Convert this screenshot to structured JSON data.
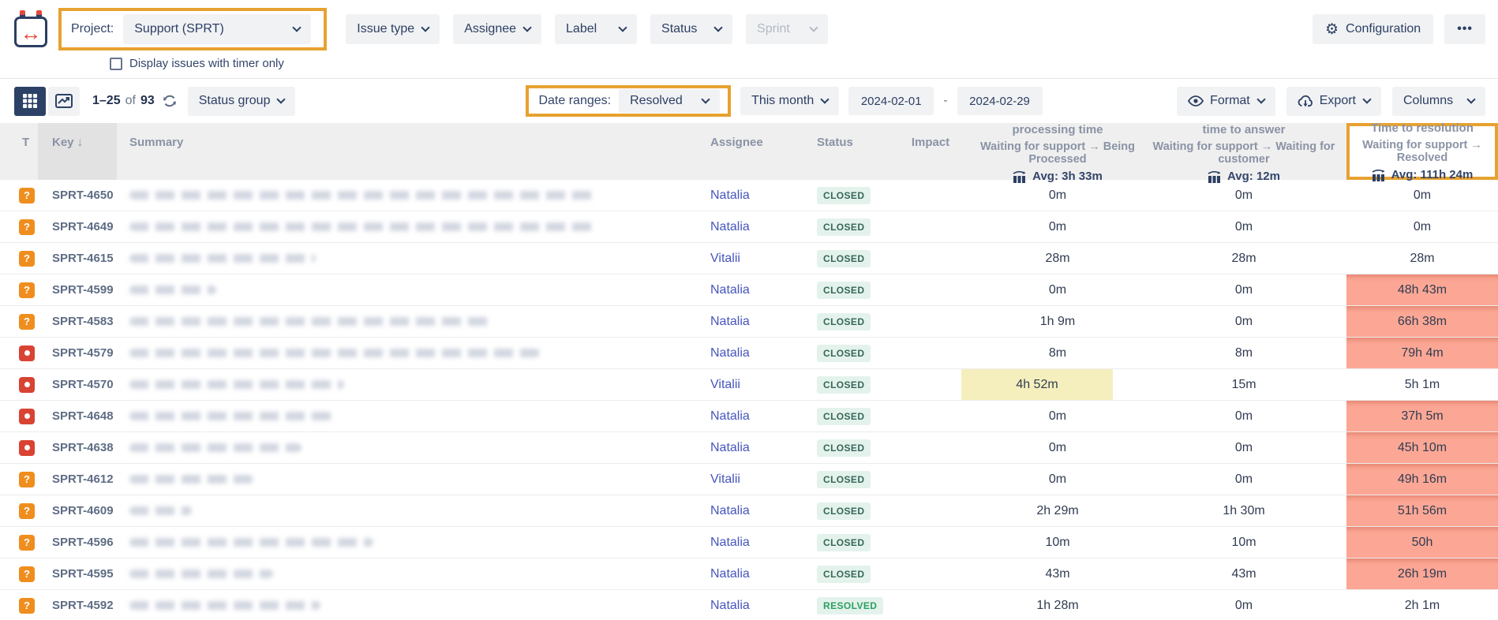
{
  "brand": {
    "logo": "calendar-sync-logo",
    "logo_arrow_glyph": "↔"
  },
  "filters": {
    "project_label": "Project:",
    "project_value": "Support (SPRT)",
    "issue_type": "Issue type",
    "assignee": "Assignee",
    "label": "Label",
    "status": "Status",
    "sprint": "Sprint"
  },
  "topbar_actions": {
    "configuration": "Configuration",
    "more": "•••"
  },
  "timer_checkbox_label": "Display issues with timer only",
  "toolbar": {
    "pagination_range": "1–25",
    "pagination_of": "of",
    "pagination_total": "93",
    "status_group": "Status group",
    "date_ranges_label": "Date ranges:",
    "date_ranges_value": "Resolved",
    "period": "This month",
    "date_from": "2024-02-01",
    "date_dash": "-",
    "date_to": "2024-02-29",
    "format": "Format",
    "export": "Export",
    "columns": "Columns"
  },
  "table": {
    "headers": {
      "type": "T",
      "key": "Key",
      "sort_desc_glyph": "↓",
      "summary": "Summary",
      "assignee": "Assignee",
      "status": "Status",
      "impact": "Impact",
      "processing": {
        "title": "processing time",
        "subtitle": "Waiting for support → Being Processed",
        "avg": "Avg: 3h 33m"
      },
      "answer": {
        "title": "time to answer",
        "subtitle": "Waiting for support → Waiting for customer",
        "avg": "Avg: 12m"
      },
      "resolution": {
        "title": "Time to resolution",
        "subtitle": "Waiting for support → Resolved",
        "avg": "Avg: 111h 24m"
      }
    },
    "rows": [
      {
        "key": "SPRT-4650",
        "type": "question",
        "assignee": "Natalia",
        "status": "CLOSED",
        "processing": "0m",
        "answer": "0m",
        "resolution": "0m",
        "resolution_alert": false,
        "processing_highlight": false,
        "summary_blur_width": 590
      },
      {
        "key": "SPRT-4649",
        "type": "question",
        "assignee": "Natalia",
        "status": "CLOSED",
        "processing": "0m",
        "answer": "0m",
        "resolution": "0m",
        "resolution_alert": false,
        "processing_highlight": false,
        "summary_blur_width": 590
      },
      {
        "key": "SPRT-4615",
        "type": "question",
        "assignee": "Vitalii",
        "status": "CLOSED",
        "processing": "28m",
        "answer": "28m",
        "resolution": "28m",
        "resolution_alert": false,
        "processing_highlight": false,
        "summary_blur_width": 236
      },
      {
        "key": "SPRT-4599",
        "type": "question",
        "assignee": "Natalia",
        "status": "CLOSED",
        "processing": "0m",
        "answer": "0m",
        "resolution": "48h 43m",
        "resolution_alert": true,
        "processing_highlight": false,
        "summary_blur_width": 110
      },
      {
        "key": "SPRT-4583",
        "type": "question",
        "assignee": "Natalia",
        "status": "CLOSED",
        "processing": "1h 9m",
        "answer": "0m",
        "resolution": "66h 38m",
        "resolution_alert": true,
        "processing_highlight": false,
        "summary_blur_width": 460
      },
      {
        "key": "SPRT-4579",
        "type": "bug",
        "assignee": "Natalia",
        "status": "CLOSED",
        "processing": "8m",
        "answer": "8m",
        "resolution": "79h 4m",
        "resolution_alert": true,
        "processing_highlight": false,
        "summary_blur_width": 520
      },
      {
        "key": "SPRT-4570",
        "type": "bug",
        "assignee": "Vitalii",
        "status": "CLOSED",
        "processing": "4h 52m",
        "answer": "15m",
        "resolution": "5h 1m",
        "resolution_alert": false,
        "processing_highlight": true,
        "summary_blur_width": 272
      },
      {
        "key": "SPRT-4648",
        "type": "bug",
        "assignee": "Natalia",
        "status": "CLOSED",
        "processing": "0m",
        "answer": "0m",
        "resolution": "37h 5m",
        "resolution_alert": true,
        "processing_highlight": false,
        "summary_blur_width": 260
      },
      {
        "key": "SPRT-4638",
        "type": "bug",
        "assignee": "Natalia",
        "status": "CLOSED",
        "processing": "0m",
        "answer": "0m",
        "resolution": "45h 10m",
        "resolution_alert": true,
        "processing_highlight": false,
        "summary_blur_width": 218
      },
      {
        "key": "SPRT-4612",
        "type": "question",
        "assignee": "Vitalii",
        "status": "CLOSED",
        "processing": "0m",
        "answer": "0m",
        "resolution": "49h 16m",
        "resolution_alert": true,
        "processing_highlight": false,
        "summary_blur_width": 157
      },
      {
        "key": "SPRT-4609",
        "type": "question",
        "assignee": "Natalia",
        "status": "CLOSED",
        "processing": "2h 29m",
        "answer": "1h 30m",
        "resolution": "51h 56m",
        "resolution_alert": true,
        "processing_highlight": false,
        "summary_blur_width": 79
      },
      {
        "key": "SPRT-4596",
        "type": "question",
        "assignee": "Natalia",
        "status": "CLOSED",
        "processing": "10m",
        "answer": "10m",
        "resolution": "50h",
        "resolution_alert": true,
        "processing_highlight": false,
        "summary_blur_width": 309
      },
      {
        "key": "SPRT-4595",
        "type": "question",
        "assignee": "Natalia",
        "status": "CLOSED",
        "processing": "43m",
        "answer": "43m",
        "resolution": "26h 19m",
        "resolution_alert": true,
        "processing_highlight": false,
        "summary_blur_width": 182
      },
      {
        "key": "SPRT-4592",
        "type": "question",
        "assignee": "Natalia",
        "status": "RESOLVED",
        "processing": "1h 28m",
        "answer": "0m",
        "resolution": "2h 1m",
        "resolution_alert": false,
        "processing_highlight": false,
        "summary_blur_width": 242
      }
    ]
  },
  "colors": {
    "accent_highlight": "#e6a230",
    "navy": "#2c3f63",
    "alert_cell": "#fca795",
    "highlight_cell": "#f5efbe",
    "badge_bg": "#e4f2ec",
    "badge_closed_text": "#356758",
    "badge_resolved_text": "#2aa05f",
    "question_icon": "#ef8e1e",
    "bug_icon": "#d94333",
    "link_blue": "#4655bc",
    "logo_red": "#e5493a"
  }
}
